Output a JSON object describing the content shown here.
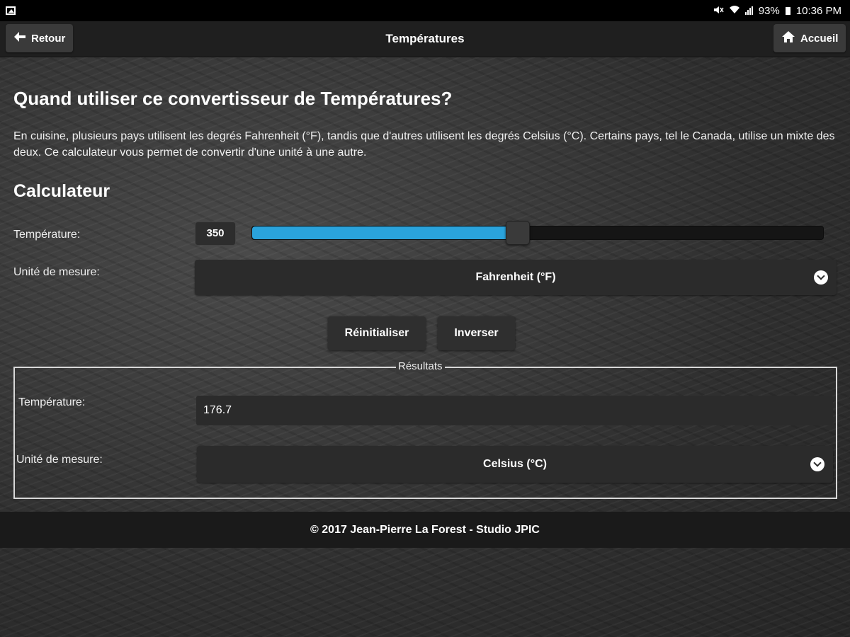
{
  "statusbar": {
    "battery": "93%",
    "time": "10:36 PM",
    "icons": [
      "image-icon",
      "mute-icon",
      "wifi-icon",
      "signal-icon",
      "battery-icon"
    ]
  },
  "navbar": {
    "back_label": "Retour",
    "title": "Températures",
    "home_label": "Accueil",
    "icons": [
      "arrow-left-icon",
      "home-icon"
    ]
  },
  "intro": {
    "heading": "Quand utiliser ce convertisseur de Températures?",
    "text": "En cuisine, plusieurs pays utilisent les degrés Fahrenheit (°F), tandis que d'autres utilisent les degrés Celsius (°C). Certains pays, tel le Canada, utilise un mixte des deux. Ce calculateur vous permet de convertir d'une unité à une autre."
  },
  "calculator": {
    "heading": "Calculateur",
    "temperature_label": "Température:",
    "temperature_value": "350",
    "slider_fraction": 0.465,
    "unit_label": "Unité de mesure:",
    "unit_selected": "Fahrenheit (°F)",
    "reset_label": "Réinitialiser",
    "invert_label": "Inverser"
  },
  "results": {
    "legend": "Résultats",
    "temperature_label": "Température:",
    "temperature_value": "176.7",
    "unit_label": "Unité de mesure:",
    "unit_selected": "Celsius (°C)"
  },
  "footer": {
    "text": "© 2017 Jean-Pierre La Forest - Studio JPIC"
  },
  "colors": {
    "accent": "#2aa3dc",
    "bar": "#1f1f1f",
    "control": "#2b2b2b"
  }
}
